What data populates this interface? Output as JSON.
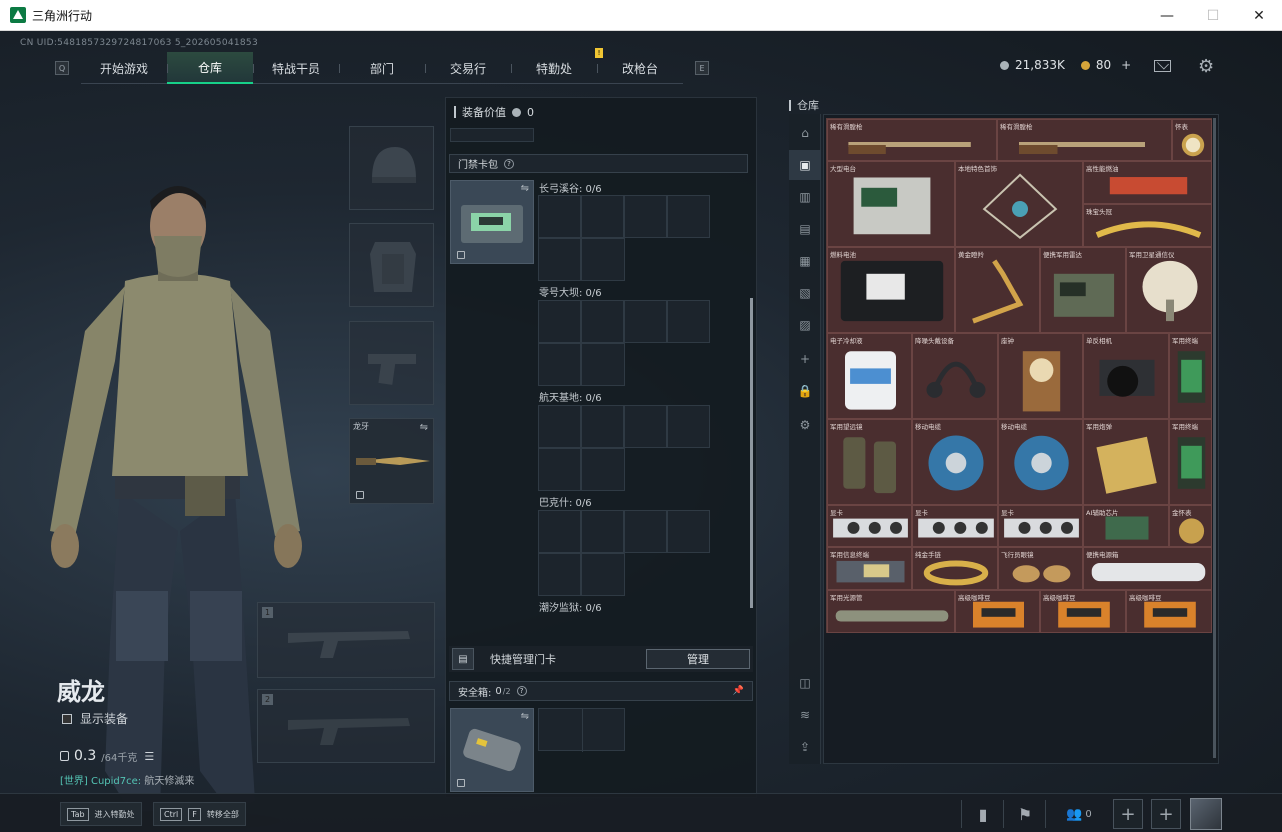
{
  "window": {
    "title": "三角洲行动",
    "minimize": "—",
    "maximize": "☐",
    "close": "✕"
  },
  "uid": "CN UID:5481857329724817063 5_202605041853",
  "nav": {
    "left_key": "Q",
    "right_key": "E",
    "tabs": [
      {
        "label": "开始游戏"
      },
      {
        "label": "仓库",
        "active": true
      },
      {
        "label": "特战干员"
      },
      {
        "label": "部门"
      },
      {
        "label": "交易行"
      },
      {
        "label": "特勤处",
        "badge": "!"
      },
      {
        "label": "改枪台"
      }
    ]
  },
  "currency": {
    "silver": "21,833K",
    "gold": "80",
    "plus": "+"
  },
  "operator": {
    "name": "威龙",
    "show_equipment": "显示装备",
    "weight": "0.3",
    "weight_max": "/64千克",
    "chat_channel": "[世界] Cupid7ce:",
    "chat_text": " 航天修滅来"
  },
  "slots": {
    "melee_label": "龙牙",
    "weapon1_num": "1",
    "weapon2_num": "2"
  },
  "mid": {
    "equip_value_label": "装备价值",
    "equip_value": "0",
    "keycard_title": "门禁卡包",
    "help": "?",
    "maps": [
      {
        "label": "长弓溪谷: 0/6"
      },
      {
        "label": "零号大坝: 0/6"
      },
      {
        "label": "航天基地: 0/6"
      },
      {
        "label": "巴克什: 0/6"
      },
      {
        "label": "潮汐监狱: 0/6"
      }
    ],
    "quick_manage": "快捷管理门卡",
    "manage": "管理",
    "safebox_label": "安全箱:",
    "safebox_count": "0",
    "safebox_max": "/2"
  },
  "storage": {
    "title": "仓库",
    "items": [
      {
        "name": "稀有滑膛枪"
      },
      {
        "name": "稀有滑膛枪"
      },
      {
        "name": "怀表"
      },
      {
        "name": "大型电台"
      },
      {
        "name": "本地特色首饰"
      },
      {
        "name": "高性能燃油"
      },
      {
        "name": "珠宝头冠"
      },
      {
        "name": "燃料电池"
      },
      {
        "name": "黄金瞪羚"
      },
      {
        "name": "便携军用雷达"
      },
      {
        "name": "军用卫星通信仪"
      },
      {
        "name": "电子冷却液"
      },
      {
        "name": "降噪头戴设备"
      },
      {
        "name": "座钟"
      },
      {
        "name": "单反相机"
      },
      {
        "name": "军用终端"
      },
      {
        "name": "军用望远镜"
      },
      {
        "name": "移动电缆"
      },
      {
        "name": "移动电缆"
      },
      {
        "name": "军用炮弹"
      },
      {
        "name": "军用终端"
      },
      {
        "name": "显卡"
      },
      {
        "name": "显卡"
      },
      {
        "name": "显卡"
      },
      {
        "name": "AI辅助芯片"
      },
      {
        "name": "金怀表"
      },
      {
        "name": "军用信息终端"
      },
      {
        "name": "纯金手链"
      },
      {
        "name": "飞行员眼镜"
      },
      {
        "name": "便携电源箱"
      },
      {
        "name": "军用光源管"
      },
      {
        "name": "高级咖啡豆"
      },
      {
        "name": "高级咖啡豆"
      },
      {
        "name": "高级咖啡豆"
      }
    ]
  },
  "bottom": {
    "tab_key": "Tab",
    "tab_label": "进入特勤处",
    "ctrl_key": "Ctrl",
    "f_key": "F",
    "ctrl_label": "转移全部",
    "friends_count": "0",
    "plus": "+"
  },
  "colors": {
    "accent": "#17d089",
    "highlight": "#f0c533",
    "item_bg": "#4a2e2f"
  }
}
